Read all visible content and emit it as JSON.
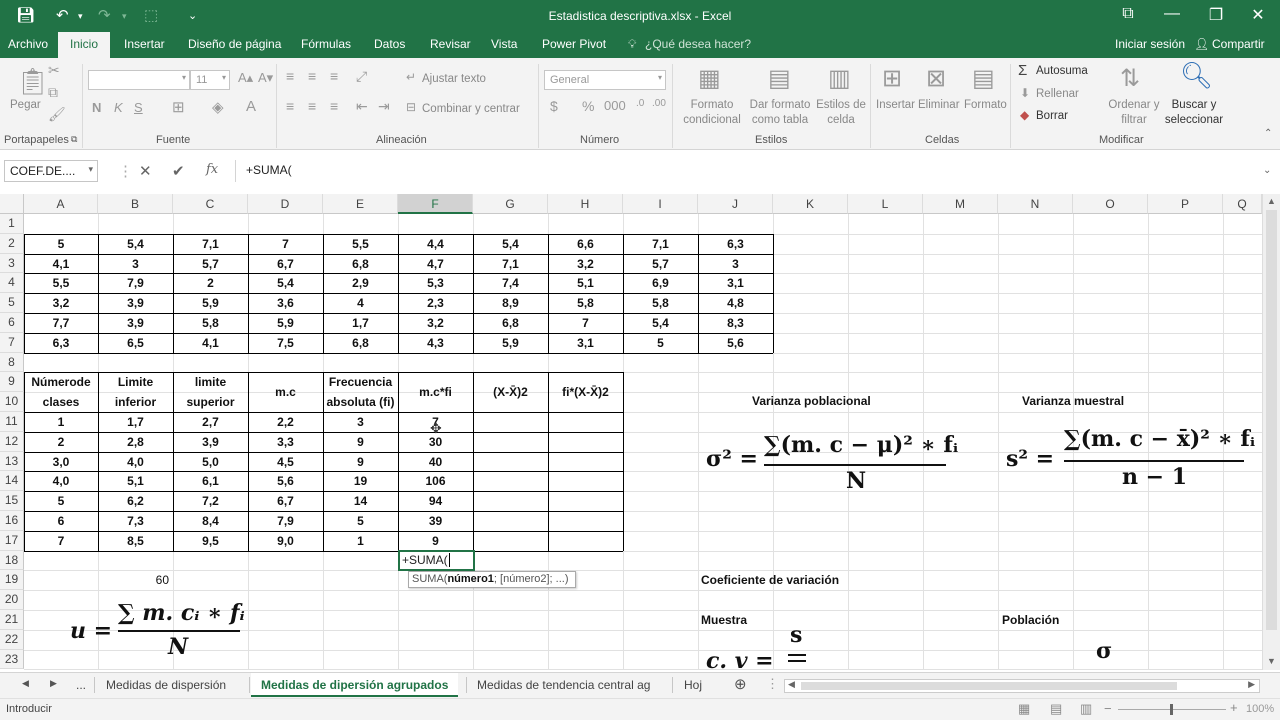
{
  "window": {
    "title": "Estadistica descriptiva.xlsx - Excel",
    "minimize": "—",
    "restore": "❐",
    "close": "✕",
    "ribbon_display": "⧉"
  },
  "menu": {
    "tabs": [
      "Archivo",
      "Inicio",
      "Insertar",
      "Diseño de página",
      "Fórmulas",
      "Datos",
      "Revisar",
      "Vista",
      "Power Pivot"
    ],
    "tell_me": "¿Qué desea hacer?",
    "sign_in": "Iniciar sesión",
    "share": "Compartir"
  },
  "ribbon": {
    "paste": "Pegar",
    "font_size": "11",
    "wrap_text": "Ajustar texto",
    "merge_center": "Combinar y centrar",
    "number_format": "General",
    "conditional_format": [
      "Formato",
      "condicional"
    ],
    "format_table": [
      "Dar formato",
      "como tabla"
    ],
    "cell_styles": [
      "Estilos de",
      "celda"
    ],
    "insert": "Insertar",
    "delete": "Eliminar",
    "format": "Formato",
    "autosum": "Autosuma",
    "fill": "Rellenar",
    "clear": "Borrar",
    "sort_filter": [
      "Ordenar y",
      "filtrar"
    ],
    "find_select": [
      "Buscar y",
      "seleccionar"
    ],
    "groups": [
      "Portapapeles",
      "Fuente",
      "Alineación",
      "Número",
      "Estilos",
      "Celdas",
      "Modificar"
    ],
    "bold": "N",
    "italic": "K",
    "underline": "S"
  },
  "formula_bar": {
    "name_box": "COEF.DE....",
    "cancel": "✕",
    "enter": "✔",
    "fx": "fx",
    "content": "+SUMA("
  },
  "columns": [
    "A",
    "B",
    "C",
    "D",
    "E",
    "F",
    "G",
    "H",
    "I",
    "J",
    "K",
    "L",
    "M",
    "N",
    "O",
    "P",
    "Q"
  ],
  "rows": [
    "1",
    "2",
    "3",
    "4",
    "5",
    "6",
    "7",
    "8",
    "9",
    "10",
    "11",
    "12",
    "13",
    "14",
    "15",
    "16",
    "17",
    "18",
    "19",
    "20",
    "21",
    "22",
    "23"
  ],
  "data_table": [
    [
      "5",
      "5,4",
      "7,1",
      "7",
      "5,5",
      "4,4",
      "5,4",
      "6,6",
      "7,1",
      "6,3"
    ],
    [
      "4,1",
      "3",
      "5,7",
      "6,7",
      "6,8",
      "4,7",
      "7,1",
      "3,2",
      "5,7",
      "3"
    ],
    [
      "5,5",
      "7,9",
      "2",
      "5,4",
      "2,9",
      "5,3",
      "7,4",
      "5,1",
      "6,9",
      "3,1"
    ],
    [
      "3,2",
      "3,9",
      "5,9",
      "3,6",
      "4",
      "2,3",
      "8,9",
      "5,8",
      "5,8",
      "4,8"
    ],
    [
      "7,7",
      "3,9",
      "5,8",
      "5,9",
      "1,7",
      "3,2",
      "6,8",
      "7",
      "5,4",
      "8,3"
    ],
    [
      "6,3",
      "6,5",
      "4,1",
      "7,5",
      "6,8",
      "4,3",
      "5,9",
      "3,1",
      "5",
      "5,6"
    ]
  ],
  "freq_headers": [
    [
      "Númerode",
      "clases"
    ],
    [
      "Limite",
      "inferior"
    ],
    [
      "limite",
      "superior"
    ],
    [
      "m.c",
      ""
    ],
    [
      "Frecuencia",
      "absoluta (fi)"
    ],
    [
      "m.c*fi",
      ""
    ],
    [
      "(X-X̄)2",
      ""
    ],
    [
      "fi*(X-X̄)2",
      ""
    ]
  ],
  "freq_rows": [
    [
      "1",
      "1,7",
      "2,7",
      "2,2",
      "3",
      "7"
    ],
    [
      "2",
      "2,8",
      "3,9",
      "3,3",
      "9",
      "30"
    ],
    [
      "3,0",
      "4,0",
      "5,0",
      "4,5",
      "9",
      "40"
    ],
    [
      "4,0",
      "5,1",
      "6,1",
      "5,6",
      "19",
      "106"
    ],
    [
      "5",
      "6,2",
      "7,2",
      "6,7",
      "14",
      "94"
    ],
    [
      "6",
      "7,3",
      "8,4",
      "7,9",
      "5",
      "39"
    ],
    [
      "7",
      "8,5",
      "9,5",
      "9,0",
      "1",
      "9"
    ]
  ],
  "editing_cell": "+SUMA(",
  "tooltip": {
    "fn": "SUMA(",
    "arg1": "número1",
    "rest": "; [número2]; ...)"
  },
  "b19_value": "60",
  "labels": {
    "varianza_poblacional": "Varianza poblacional",
    "varianza_muestral": "Varianza muestral",
    "coef_variacion": "Coeficiente de variación",
    "muestra": "Muestra",
    "poblacion": "Población"
  },
  "formulas": {
    "mean_lhs": "u =",
    "mean_num": "∑ m. cᵢ ∗ fᵢ",
    "mean_den": "N",
    "var_pop_lhs": "σ² =",
    "var_pop_num": "∑(m. c − μ)² ∗ fᵢ",
    "var_pop_den": "N",
    "var_sample_lhs": "s² =",
    "var_sample_num": "∑(m. c − x̄)² ∗ fᵢ",
    "var_sample_den": "n − 1",
    "cv_sample_lhs": "c. v =",
    "cv_sample_num": "s",
    "cv_pop_num": "σ"
  },
  "sheet_tabs": [
    "...",
    "Medidas de dispersión",
    "Medidas de dipersión agrupados",
    "Medidas de tendencia central ag",
    "Hoj"
  ],
  "status": {
    "mode": "Introducir",
    "zoom": "100%"
  }
}
